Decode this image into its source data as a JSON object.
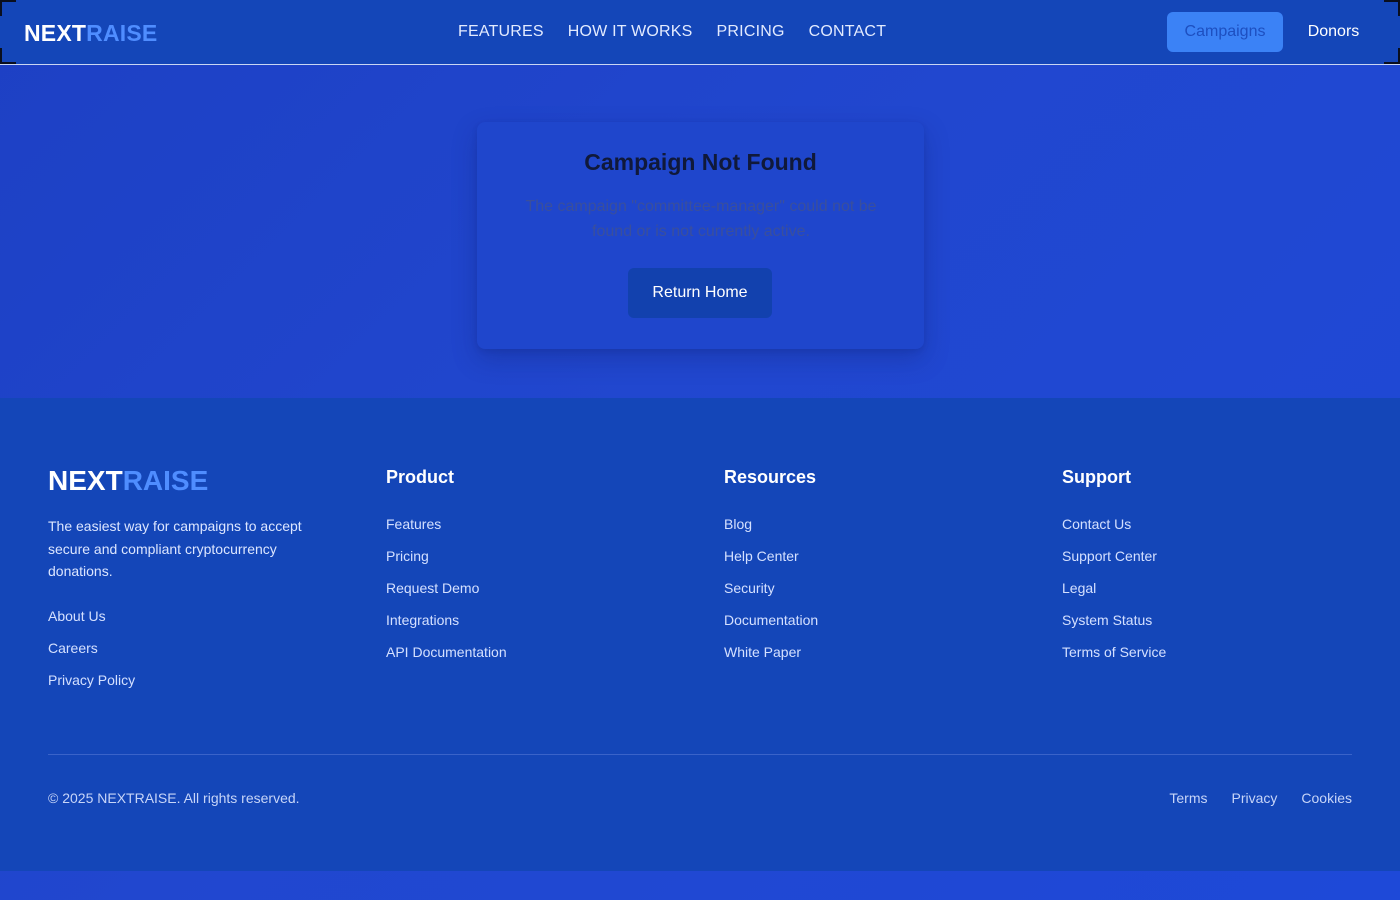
{
  "header": {
    "logo_part1": "NEXT",
    "logo_part2": "RAISE",
    "nav": [
      "FEATURES",
      "HOW IT WORKS",
      "PRICING",
      "CONTACT"
    ],
    "campaigns_label": "Campaigns",
    "donors_label": "Donors"
  },
  "card": {
    "title": "Campaign Not Found",
    "message": "The campaign \"committee-manager\" could not be found or is not currently active.",
    "button_label": "Return Home"
  },
  "footer": {
    "logo_part1": "NEXT",
    "logo_part2": "RAISE",
    "description": "The easiest way for campaigns to accept secure and compliant cryptocurrency donations.",
    "company_links": [
      "About Us",
      "Careers",
      "Privacy Policy"
    ],
    "columns": [
      {
        "title": "Product",
        "links": [
          "Features",
          "Pricing",
          "Request Demo",
          "Integrations",
          "API Documentation"
        ]
      },
      {
        "title": "Resources",
        "links": [
          "Blog",
          "Help Center",
          "Security",
          "Documentation",
          "White Paper"
        ]
      },
      {
        "title": "Support",
        "links": [
          "Contact Us",
          "Support Center",
          "Legal",
          "System Status",
          "Terms of Service"
        ]
      }
    ],
    "copyright": "© 2025 NEXTRAISE. All rights reserved.",
    "legal_links": [
      "Terms",
      "Privacy",
      "Cookies"
    ]
  },
  "colors": {
    "brand_blue": "#1446b8",
    "accent_blue": "#3b82f6",
    "logo_accent": "#4f8dff"
  }
}
